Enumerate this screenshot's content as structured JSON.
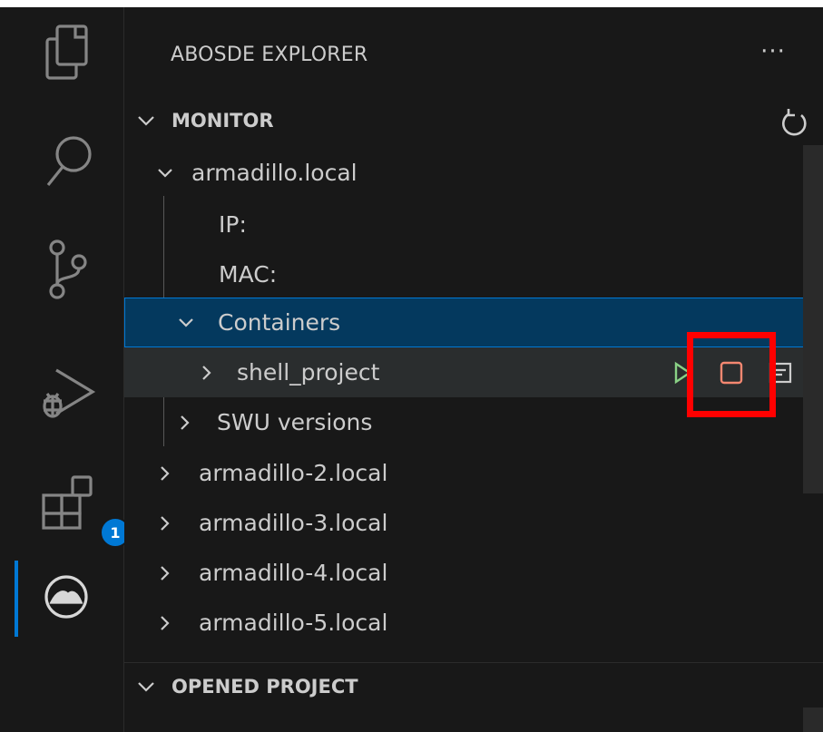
{
  "colors": {
    "background": "#181818",
    "selection_bg": "#04395e",
    "focus_border": "#0078d4",
    "badge_bg": "#0078d4",
    "hover_bg": "#2a2d2e",
    "highlight_box": "#ff0000",
    "run_icon": "#89d185",
    "stop_icon": "#f48771"
  },
  "activity_bar": {
    "items": [
      {
        "name": "explorer",
        "icon": "files-icon"
      },
      {
        "name": "search",
        "icon": "search-icon"
      },
      {
        "name": "source-control",
        "icon": "source-control-icon"
      },
      {
        "name": "run-and-debug",
        "icon": "run-debug-icon"
      },
      {
        "name": "extensions",
        "icon": "extensions-icon",
        "badge": "1"
      },
      {
        "name": "abosde",
        "icon": "abosde-icon",
        "active": true
      }
    ]
  },
  "sidebar": {
    "title": "ABOSDE EXPLORER",
    "more_label": "···",
    "monitor": {
      "header": "MONITOR",
      "refresh_icon": "refresh-icon",
      "device": {
        "name": "armadillo.local",
        "ip_label": "IP:",
        "mac_label": "MAC:",
        "containers_label": "Containers",
        "container": {
          "name": "shell_project",
          "actions": [
            "run-icon",
            "stop-icon",
            "log-icon"
          ]
        },
        "swu_label": "SWU versions"
      },
      "other_devices": [
        "armadillo-2.local",
        "armadillo-3.local",
        "armadillo-4.local",
        "armadillo-5.local"
      ]
    },
    "opened_project": {
      "header": "OPENED PROJECT"
    }
  }
}
